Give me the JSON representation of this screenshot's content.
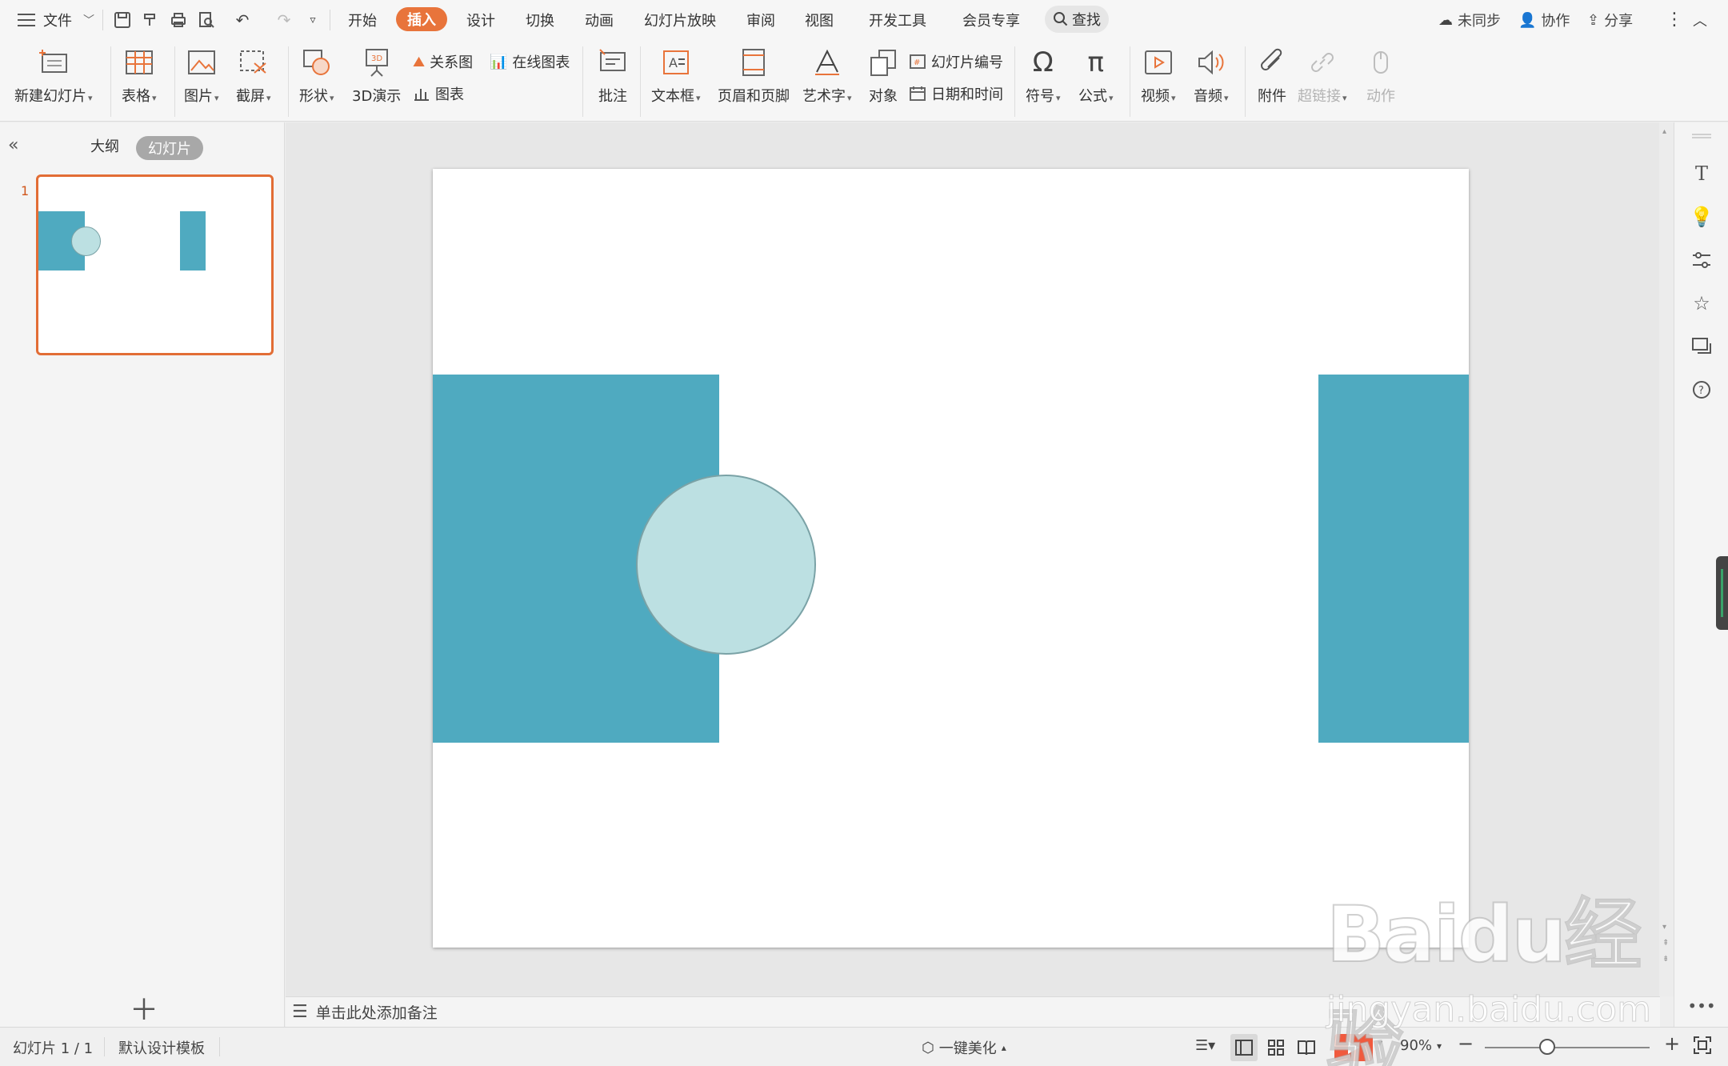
{
  "menu": {
    "file": "文件",
    "tabs": [
      "开始",
      "插入",
      "设计",
      "切换",
      "动画",
      "幻灯片放映",
      "审阅",
      "视图",
      "开发工具",
      "会员专享"
    ],
    "active_tab": "插入",
    "search": "查找",
    "right": {
      "sync": "未同步",
      "collab": "协作",
      "share": "分享"
    }
  },
  "ribbon": {
    "new_slide": "新建幻灯片",
    "table": "表格",
    "picture": "图片",
    "screenshot": "截屏",
    "shape": "形状",
    "demo3d": "3D演示",
    "relation": "关系图",
    "online_chart": "在线图表",
    "chart": "图表",
    "comment": "批注",
    "textbox": "文本框",
    "header_footer": "页眉和页脚",
    "wordart": "艺术字",
    "object": "对象",
    "slide_number": "幻灯片编号",
    "datetime": "日期和时间",
    "symbol": "符号",
    "formula": "公式",
    "video": "视频",
    "audio": "音频",
    "attachment": "附件",
    "hyperlink": "超链接",
    "action": "动作"
  },
  "left_panel": {
    "tab_outline": "大纲",
    "tab_slides": "幻灯片",
    "slide_number": "1"
  },
  "notes": {
    "placeholder": "单击此处添加备注"
  },
  "status": {
    "slide_info": "幻灯片 1 / 1",
    "template": "默认设计模板",
    "beautify": "一键美化",
    "zoom": "90%",
    "zoom_fraction": 0.38
  },
  "slide": {
    "colors": {
      "teal": "#4faac0",
      "light_teal": "#bce0e2",
      "circle_border": "#7aa2a6"
    }
  },
  "watermark": {
    "line1": "Baidu经验",
    "line2": "jingyan.baidu.com"
  },
  "colors": {
    "accent": "#e8743b",
    "play": "#f05a3e"
  }
}
